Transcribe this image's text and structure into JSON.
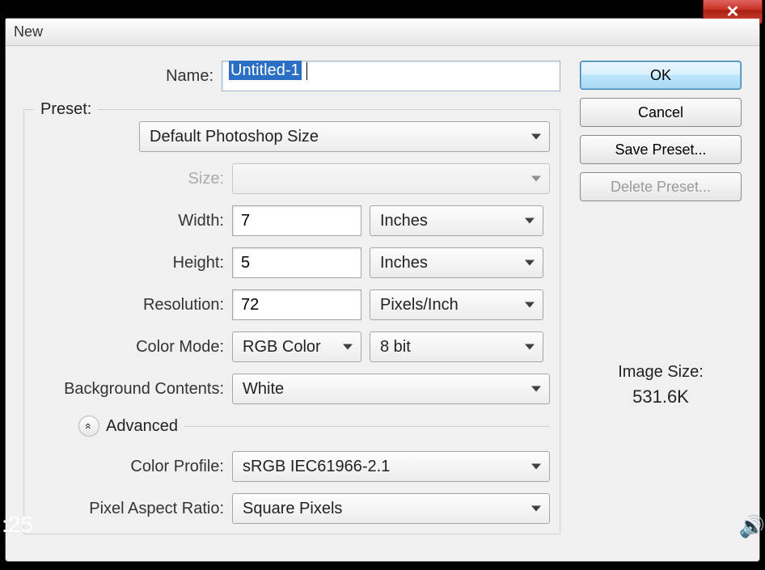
{
  "window": {
    "title": "New"
  },
  "labels": {
    "name": "Name:",
    "preset": "Preset:",
    "size": "Size:",
    "width": "Width:",
    "height": "Height:",
    "resolution": "Resolution:",
    "color_mode": "Color Mode:",
    "background": "Background Contents:",
    "advanced": "Advanced",
    "color_profile": "Color Profile:",
    "pixel_aspect": "Pixel Aspect Ratio:"
  },
  "values": {
    "name": "Untitled-1",
    "preset": "Default Photoshop Size",
    "size": "",
    "width": "7",
    "width_unit": "Inches",
    "height": "5",
    "height_unit": "Inches",
    "resolution": "72",
    "resolution_unit": "Pixels/Inch",
    "color_mode": "RGB Color",
    "color_depth": "8 bit",
    "background": "White",
    "color_profile": "sRGB IEC61966-2.1",
    "pixel_aspect": "Square Pixels"
  },
  "buttons": {
    "ok": "OK",
    "cancel": "Cancel",
    "save_preset": "Save Preset...",
    "delete_preset": "Delete Preset..."
  },
  "image_size": {
    "label": "Image Size:",
    "value": "531.6K"
  },
  "adv_toggle": "«",
  "video": {
    "time": ":25"
  }
}
